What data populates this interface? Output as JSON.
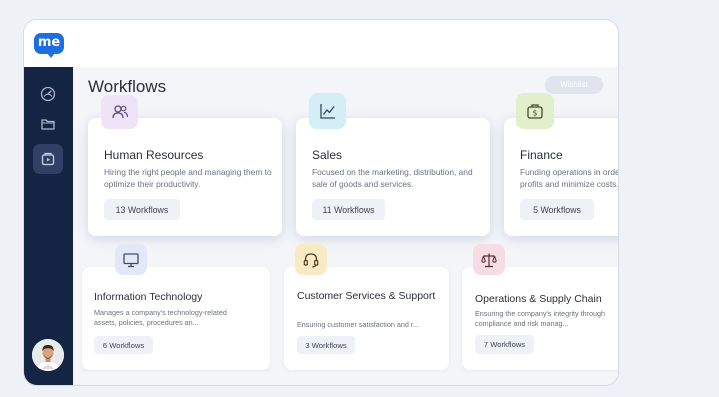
{
  "app": {
    "logo_text": "me"
  },
  "sidebar": {
    "items": [
      {
        "icon": "dashboard-gauge-icon"
      },
      {
        "icon": "folder-icon"
      },
      {
        "icon": "workflow-media-icon",
        "active": true
      }
    ],
    "avatar": {
      "icon": "user-avatar"
    }
  },
  "main": {
    "title": "Workflows",
    "wishlist_label": "Wishlist",
    "cards": [
      {
        "title": "Human Resources",
        "description": "Hiring the right people and managing them to optimize their productivity.",
        "count": "13",
        "count_label": "Workflows",
        "icon": "users-icon",
        "icon_bg": "#efe3f8"
      },
      {
        "title": "Sales",
        "description": "Focused on the marketing, distribution, and sale of goods and services.",
        "count": "11",
        "count_label": "Workflows",
        "icon": "line-chart-icon",
        "icon_bg": "#d4eef6"
      },
      {
        "title": "Finance",
        "description": "Funding operations in order to maximize profits and minimize costs.",
        "count": "5",
        "count_label": "Workflows",
        "icon": "money-bag-icon",
        "icon_bg": "#e0f0cd"
      },
      {
        "title": "Information Technology",
        "description": "Manages a company's technology-related assets, policies, procedures an...",
        "count": "6",
        "count_label": "Workflows",
        "icon": "monitor-icon",
        "icon_bg": "#e3e8f8"
      },
      {
        "title": "Customer Services & Support",
        "description": "Ensuring customer satisfaction and r...",
        "count": "3",
        "count_label": "Workflows",
        "icon": "headset-icon",
        "icon_bg": "#f8ebc4"
      },
      {
        "title": "Operations & Supply Chain",
        "description": "Ensuring the company's integrity through compliance and risk manag...",
        "count": "7",
        "count_label": "Workflows",
        "icon": "scales-icon",
        "icon_bg": "#f6dde4"
      }
    ]
  },
  "colors": {
    "sidebar_bg": "#142444",
    "brand_blue": "#1d6fe0",
    "page_bg": "#eef1f6"
  }
}
